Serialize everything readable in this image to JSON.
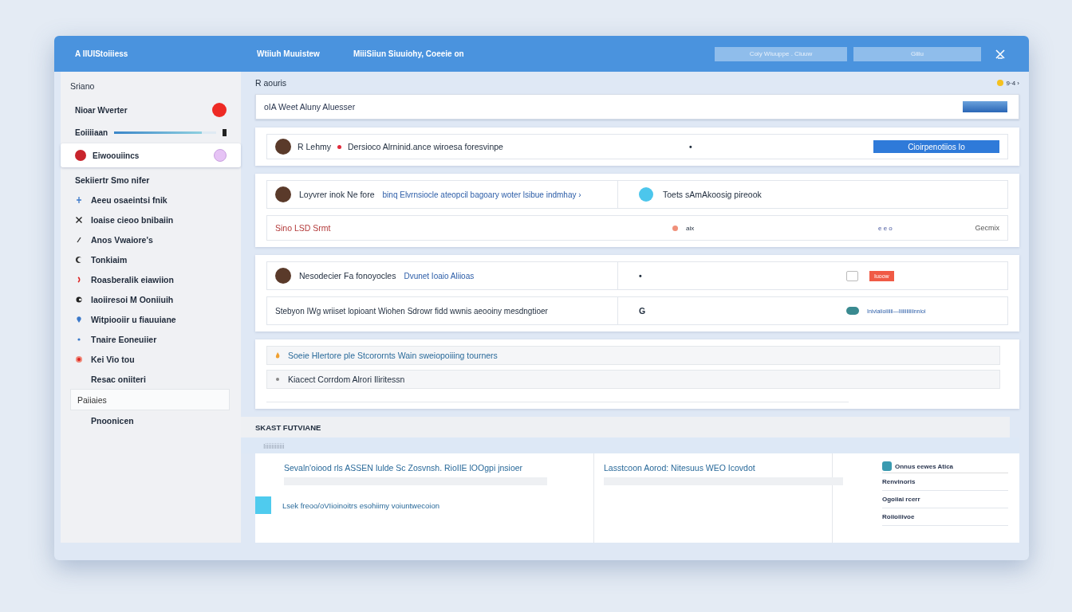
{
  "header": {
    "brand": "A IIUIStoiiiess",
    "nav": [
      "Wtiiuh Muuistew",
      "MiiiSiiun Siuuiohy, Coeeie on"
    ],
    "search_fields": [
      {
        "placeholder": "Coiy Wiuuppe . Ciuuw"
      },
      {
        "placeholder": "Giiiu"
      }
    ]
  },
  "sidebar": {
    "title": "Sriano",
    "cards": [
      {
        "kind": "dot",
        "label": "Nioar Wverter",
        "color": "#ee2a24",
        "selected": false
      },
      {
        "kind": "progress",
        "label": "Eoiiiiaan",
        "level": 0.86,
        "selected": false
      },
      {
        "kind": "avatar",
        "label": "Eiwoouiincs",
        "color": "#e6c3f5",
        "selected": true
      }
    ],
    "section_title": "Sekiiertr Smo nifer",
    "items": [
      {
        "label": "Aeeu osaeintsi fnik",
        "selected": false
      },
      {
        "label": "Ioaise cieoo bnibaiin",
        "selected": false
      },
      {
        "label": "Anos Vwaiore's",
        "selected": false
      },
      {
        "label": "Tonkiaim",
        "selected": false
      },
      {
        "label": "Roasberalik eiawiion",
        "selected": false
      },
      {
        "label": "Iaoiiresoi M Ooniiuih",
        "selected": false
      },
      {
        "label": "Witpiooiir u fiauuiane",
        "selected": false
      },
      {
        "label": "Tnaire Eoneuiier",
        "selected": false
      },
      {
        "label": "Kei Vio tou",
        "selected": false
      },
      {
        "label": "Resac oniiteri",
        "selected": false
      },
      {
        "label": "Paiiaies",
        "selected": true
      },
      {
        "label": "Pnoonicen",
        "selected": false
      }
    ]
  },
  "main": {
    "title": "R aouris",
    "status": {
      "color": "#f5c11f",
      "text": "9·4 ›"
    },
    "input": {
      "value": "oIA Weet Aluny Aluesser"
    },
    "card1": {
      "name": "R Lehmy",
      "text": "Dersioco Alrninid.ance wiroesa foresvinpe",
      "bullet": "•",
      "button": "Cioirpenotiios Io"
    },
    "card2": {
      "name": "Loyvrer inok Ne fore",
      "link": "binq Elvrnsiocle ateopcil bagoary woter lsibue indmhay ›",
      "side_text": "Toets sAmAkoosig pireook",
      "warning": "Sino LSD Srmt",
      "tag": "aix",
      "meta": "e e o",
      "right": "Gecmix"
    },
    "card3": {
      "name": "Nesodecier Fa fonoyocles",
      "link": "Dvunet Ioaio Aliioas",
      "bullet": "•",
      "badge": "Iuoow",
      "line2": "Stebyon IWg wriiset lopioant Wiohen Sdrowr fidd wwnis aeooiny mesdngtioer",
      "mark": "G",
      "footnote": "Iniviaiioiiiiii—Iiiiiiiiiiiinnioi"
    },
    "list": [
      {
        "text": "Soeie Hlertore ple Stcorornts Wain sweiopoiiing tourners"
      },
      {
        "text": "Kiacect Corrdom Alrori Iliritessn"
      }
    ],
    "section": {
      "title": "SKAST FUTVIANE",
      "subtitle": "Iiiiiiiiiiiii",
      "col1": {
        "link": "Sevaln'oiood rls ASSEN Iulde Sc Zosvnsh. RioIIE lOOgpi jnsioer",
        "note": "Lsek freoo/oVIioinoitrs esohiimy voiuntwecoion"
      },
      "col2": {
        "link": "Lasstcoon Aorod: Nitesuus WEO Icovdot"
      },
      "col3": {
        "title": "Onnus eewes Atica",
        "rows": [
          "Renvinoris",
          "Ogoiiai rcerr",
          "Roiioiiivoe"
        ]
      }
    }
  }
}
